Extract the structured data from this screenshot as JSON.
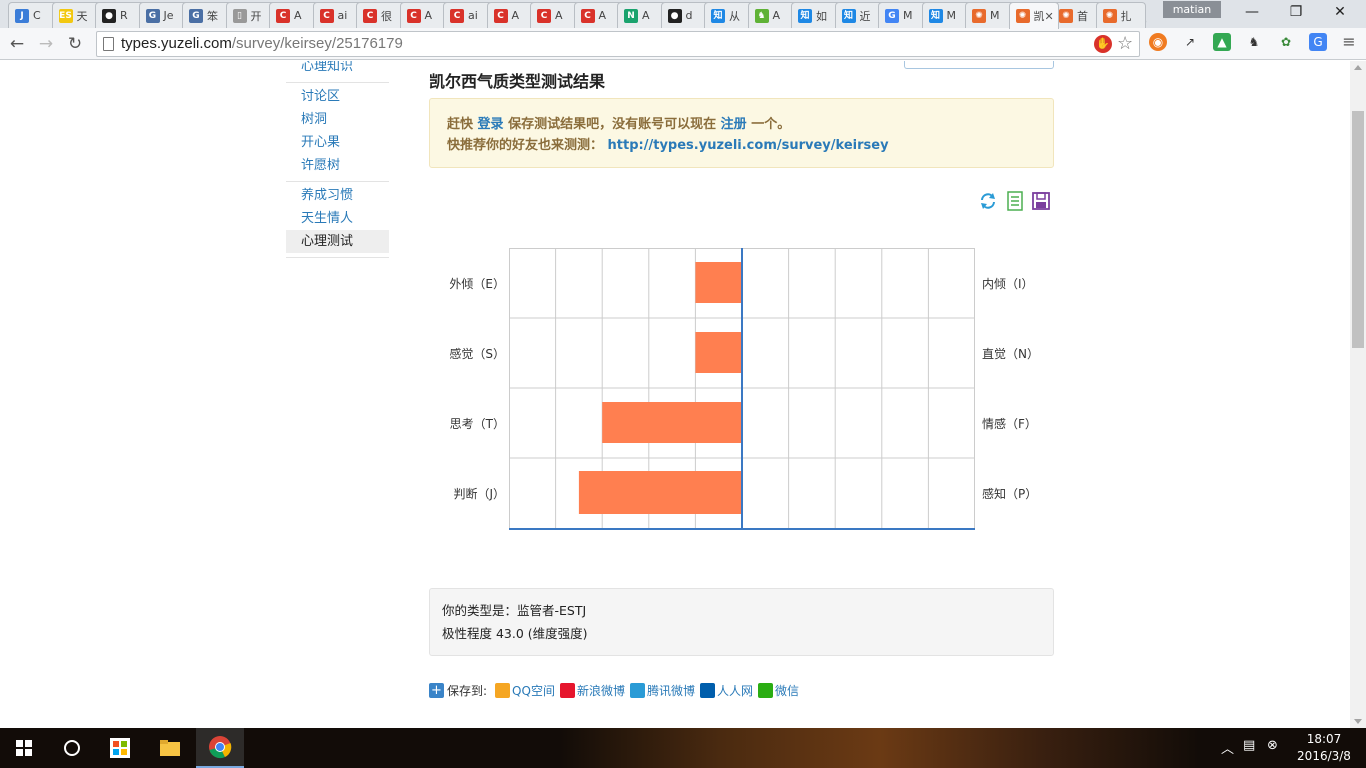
{
  "browser": {
    "tabs": [
      {
        "icon": "J",
        "label": "C",
        "color": "#3b7dd8"
      },
      {
        "icon": "ES",
        "label": "天",
        "color": "#f2c811"
      },
      {
        "icon": "github",
        "label": "R",
        "color": "#222"
      },
      {
        "icon": "G",
        "label": "Je",
        "color": "#4a6fa5"
      },
      {
        "icon": "G",
        "label": "笨",
        "color": "#4a6fa5"
      },
      {
        "icon": "doc",
        "label": "开",
        "color": "#999"
      },
      {
        "icon": "C",
        "label": "A",
        "color": "#d9322a"
      },
      {
        "icon": "C",
        "label": "ai",
        "color": "#d9322a"
      },
      {
        "icon": "C",
        "label": "很",
        "color": "#d9322a"
      },
      {
        "icon": "C",
        "label": "A",
        "color": "#d9322a"
      },
      {
        "icon": "C",
        "label": "ai",
        "color": "#d9322a"
      },
      {
        "icon": "C",
        "label": "A",
        "color": "#d9322a"
      },
      {
        "icon": "C",
        "label": "A",
        "color": "#d9322a"
      },
      {
        "icon": "C",
        "label": "A",
        "color": "#d9322a"
      },
      {
        "icon": "N",
        "label": "A",
        "color": "#1aa36e"
      },
      {
        "icon": "github",
        "label": "d",
        "color": "#222"
      },
      {
        "icon": "知",
        "label": "从",
        "color": "#1e88e5"
      },
      {
        "icon": "evernote",
        "label": "A",
        "color": "#5fb236"
      },
      {
        "icon": "知",
        "label": "如",
        "color": "#1e88e5"
      },
      {
        "icon": "知",
        "label": "近",
        "color": "#1e88e5"
      },
      {
        "icon": "G",
        "label": "M",
        "color": "#4285f4"
      },
      {
        "icon": "知",
        "label": "M",
        "color": "#1e88e5"
      },
      {
        "icon": "yuzeli",
        "label": "M",
        "color": "#e86a2c"
      },
      {
        "icon": "yuzeli",
        "label": "凯",
        "color": "#e86a2c",
        "active": true
      },
      {
        "icon": "yuzeli",
        "label": "首",
        "color": "#e86a2c"
      },
      {
        "icon": "yuzeli",
        "label": "扎",
        "color": "#e86a2c"
      }
    ],
    "profile_name": "matian",
    "url_host": "types.yuzeli.com",
    "url_path": "/survey/keirsey/25176179"
  },
  "sidebar": {
    "groups": [
      {
        "items": [
          {
            "label": "心理知识",
            "active": false
          }
        ]
      },
      {
        "items": [
          {
            "label": "讨论区",
            "active": false
          },
          {
            "label": "树洞",
            "active": false
          },
          {
            "label": "开心果",
            "active": false
          },
          {
            "label": "许愿树",
            "active": false
          }
        ]
      },
      {
        "items": [
          {
            "label": "养成习惯",
            "active": false
          },
          {
            "label": "天生情人",
            "active": false
          },
          {
            "label": "心理测试",
            "active": true
          }
        ]
      }
    ]
  },
  "page": {
    "title": "凯尔西气质类型测试结果",
    "notice": {
      "line1_pre": "赶快",
      "login": "登录",
      "line1_mid": "保存测试结果吧，没有账号可以现在",
      "register": "注册",
      "line1_post": "一个。",
      "line2_pre": "快推荐你的好友也来测测：",
      "link": "http://types.yuzeli.com/survey/keirsey"
    },
    "tools": [
      "refresh-icon",
      "document-icon",
      "save-icon"
    ],
    "result": {
      "type_line": "你的类型是：监管者-ESTJ",
      "polarity_line": "极性程度 43.0 (维度强度)"
    },
    "share": {
      "label": "保存到:",
      "targets": [
        {
          "name": "QQ空间",
          "color": "#f5a623"
        },
        {
          "name": "新浪微博",
          "color": "#e6162d"
        },
        {
          "name": "腾讯微博",
          "color": "#2a9bd6"
        },
        {
          "name": "人人网",
          "color": "#005eac"
        },
        {
          "name": "微信",
          "color": "#2bad13"
        }
      ]
    }
  },
  "chart_data": {
    "type": "bar",
    "orientation": "horizontal-diverging",
    "categories_left": [
      "外倾（E）",
      "感觉（S）",
      "思考（T）",
      "判断（J）"
    ],
    "categories_right": [
      "内倾（I）",
      "直觉（N）",
      "情感（F）",
      "感知（P）"
    ],
    "values": [
      -1,
      -1,
      -3,
      -3.5
    ],
    "xlim": [
      -5,
      5
    ],
    "grid": true,
    "bar_color": "#ff7f50",
    "axis_color": "#3a78c3"
  },
  "taskbar": {
    "time": "18:07",
    "date": "2016/3/8"
  }
}
